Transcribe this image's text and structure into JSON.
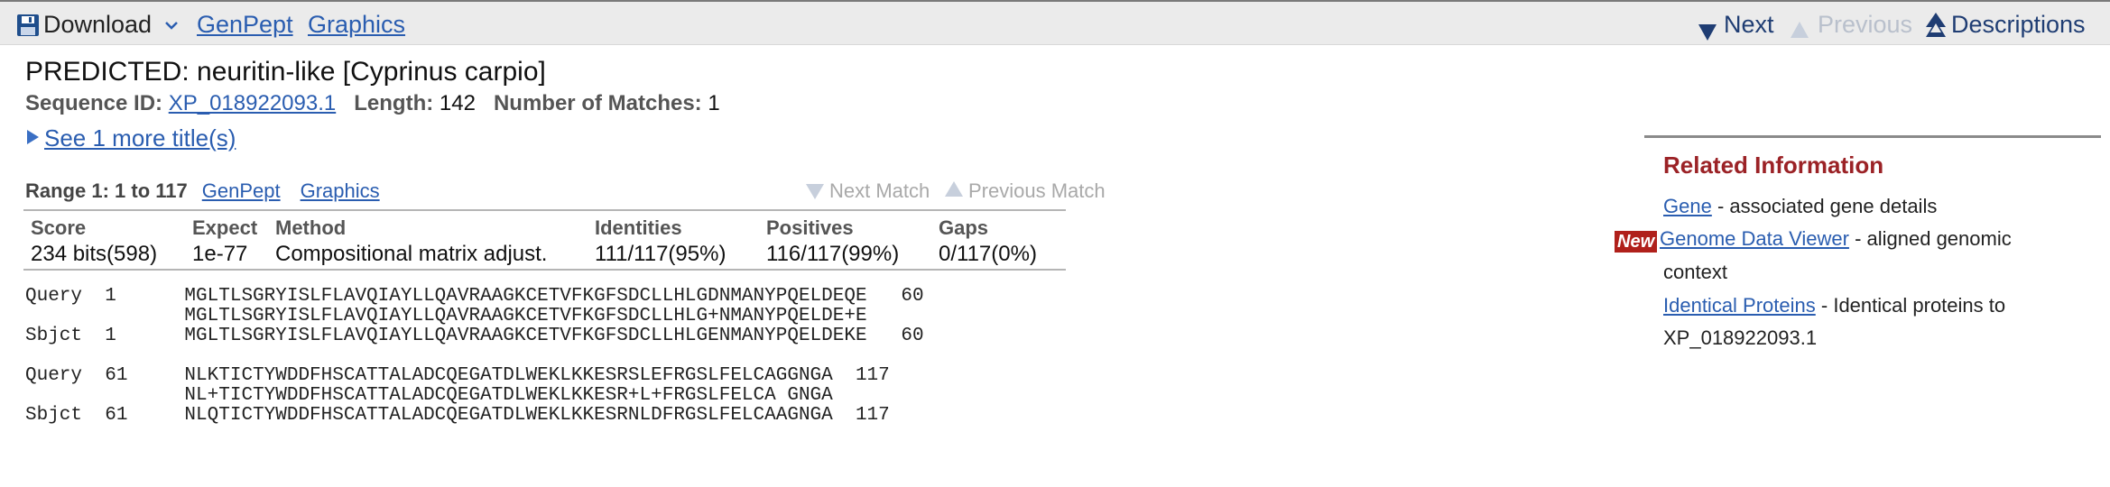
{
  "toolbar": {
    "download_label": "Download",
    "genpept_label": "GenPept",
    "graphics_label": "Graphics",
    "next_label": "Next",
    "previous_label": "Previous",
    "descriptions_label": "Descriptions"
  },
  "hit": {
    "title": "PREDICTED: neuritin-like [Cyprinus carpio]",
    "seq_id_label": "Sequence ID:",
    "seq_id": "XP_018922093.1",
    "length_label": "Length:",
    "length": "142",
    "matches_label": "Number of Matches:",
    "matches": "1",
    "see_more": "See 1 more title(s)"
  },
  "range": {
    "label": "Range 1: 1 to 117",
    "genpept_label": "GenPept",
    "graphics_label": "Graphics",
    "next_match": "Next Match",
    "previous_match": "Previous Match"
  },
  "stats": {
    "headers": [
      "Score",
      "Expect",
      "Method",
      "Identities",
      "Positives",
      "Gaps"
    ],
    "values": [
      "234 bits(598)",
      "1e-77",
      "Compositional matrix adjust.",
      "111/117(95%)",
      "116/117(99%)",
      "0/117(0%)"
    ]
  },
  "alignment": {
    "block1": [
      "Query  1      MGLTLSGRYISLFLAVQIAYLLQAVRAAGKCETVFKGFSDCLLHLGDNMANYPQELDEQE   60",
      "              MGLTLSGRYISLFLAVQIAYLLQAVRAAGKCETVFKGFSDCLLHLG+NMANYPQELDE+E",
      "Sbjct  1      MGLTLSGRYISLFLAVQIAYLLQAVRAAGKCETVFKGFSDCLLHLGENMANYPQELDEKE   60"
    ],
    "block2": [
      "Query  61     NLKTICTYWDDFHSCATTALADCQEGATDLWEKLKKESRSLEFRGSLFELCAGGNGA  117",
      "              NL+TICTYWDDFHSCATTALADCQEGATDLWEKLKKESR+L+FRGSLFELCA GNGA",
      "Sbjct  61     NLQTICTYWDDFHSCATTALADCQEGATDLWEKLKKESRNLDFRGSLFELCAAGNGA  117"
    ]
  },
  "related": {
    "title": "Related Information",
    "new_badge": "New",
    "items": [
      {
        "link": "Gene",
        "desc": "- associated gene details"
      },
      {
        "link": "Genome Data Viewer",
        "desc": "- aligned genomic",
        "desc2": "context"
      },
      {
        "link": "Identical Proteins",
        "desc": "- Identical proteins to",
        "desc2": "XP_018922093.1"
      }
    ]
  },
  "colors": {
    "link": "#2a5db0",
    "related_title": "#9b2226",
    "new_badge": "#b0201b",
    "toolbar_bg": "#ebebeb"
  }
}
